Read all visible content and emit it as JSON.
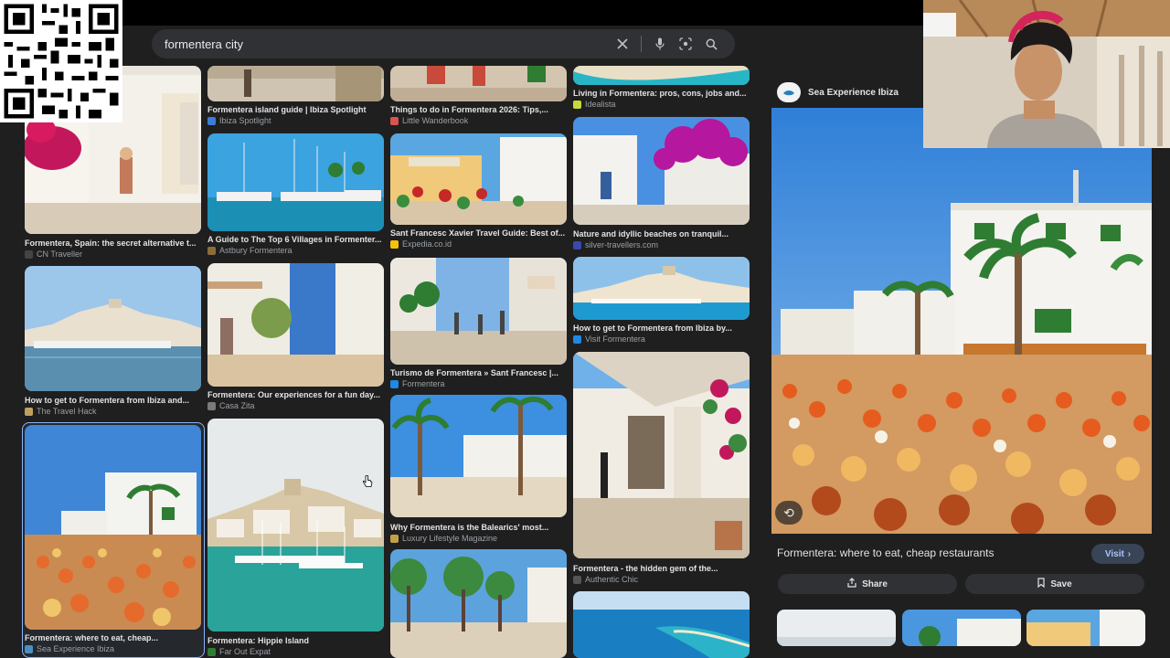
{
  "search": {
    "query": "formentera city",
    "icons": [
      "clear-icon",
      "microphone-icon",
      "lens-icon",
      "search-icon"
    ]
  },
  "results": {
    "col1": [
      {
        "title": "Formentera, Spain: the secret alternative t...",
        "source": "CN Traveller",
        "fav": "#444"
      },
      {
        "title": "How to get to Formentera from Ibiza and...",
        "source": "The Travel Hack",
        "fav": "#c0a060"
      },
      {
        "title": "Formentera: where to eat, cheap...",
        "source": "Sea Experience Ibiza",
        "fav": "#4a90c2"
      }
    ],
    "col2": [
      {
        "title": "Formentera island guide | Ibiza Spotlight",
        "source": "Ibiza Spotlight",
        "fav": "#3b7dd8"
      },
      {
        "title": "A Guide to The Top 6 Villages in Formenter...",
        "source": "Astbury Formentera",
        "fav": "#8a6d3b"
      },
      {
        "title": "Formentera: Our experiences for a fun day...",
        "source": "Casa Zita",
        "fav": "#7a7a7a"
      },
      {
        "title": "Formentera: Hippie Island",
        "source": "Far Out Expat",
        "fav": "#2e7d32"
      }
    ],
    "col3": [
      {
        "title": "Things to do in Formentera 2026: Tips,...",
        "source": "Little Wanderbook",
        "fav": "#d9534f"
      },
      {
        "title": "Sant Francesc Xavier Travel Guide: Best of...",
        "source": "Expedia.co.id",
        "fav": "#f4c20d"
      },
      {
        "title": "Turismo de Formentera » Sant Francesc |...",
        "source": "Formentera",
        "fav": "#1e88e5"
      },
      {
        "title": "Why Formentera is the Balearics' most...",
        "source": "Luxury Lifestyle Magazine",
        "fav": "#bfa14a"
      },
      {
        "title": "",
        "source": "",
        "fav": ""
      }
    ],
    "col4": [
      {
        "title": "Living in Formentera: pros, cons, jobs and...",
        "source": "Idealista",
        "fav": "#c6d93a"
      },
      {
        "title": "Nature and idyllic beaches on tranquil...",
        "source": "silver-travellers.com",
        "fav": "#3949ab"
      },
      {
        "title": "How to get to Formentera from Ibiza by...",
        "source": "Visit Formentera",
        "fav": "#1e88e5"
      },
      {
        "title": "Formentera - the hidden gem of the...",
        "source": "Authentic Chic",
        "fav": "#555"
      }
    ]
  },
  "panel": {
    "source": "Sea Experience Ibiza",
    "title": "Formentera: where to eat, cheap restaurants",
    "visit_label": "Visit",
    "share_label": "Share",
    "save_label": "Save"
  }
}
